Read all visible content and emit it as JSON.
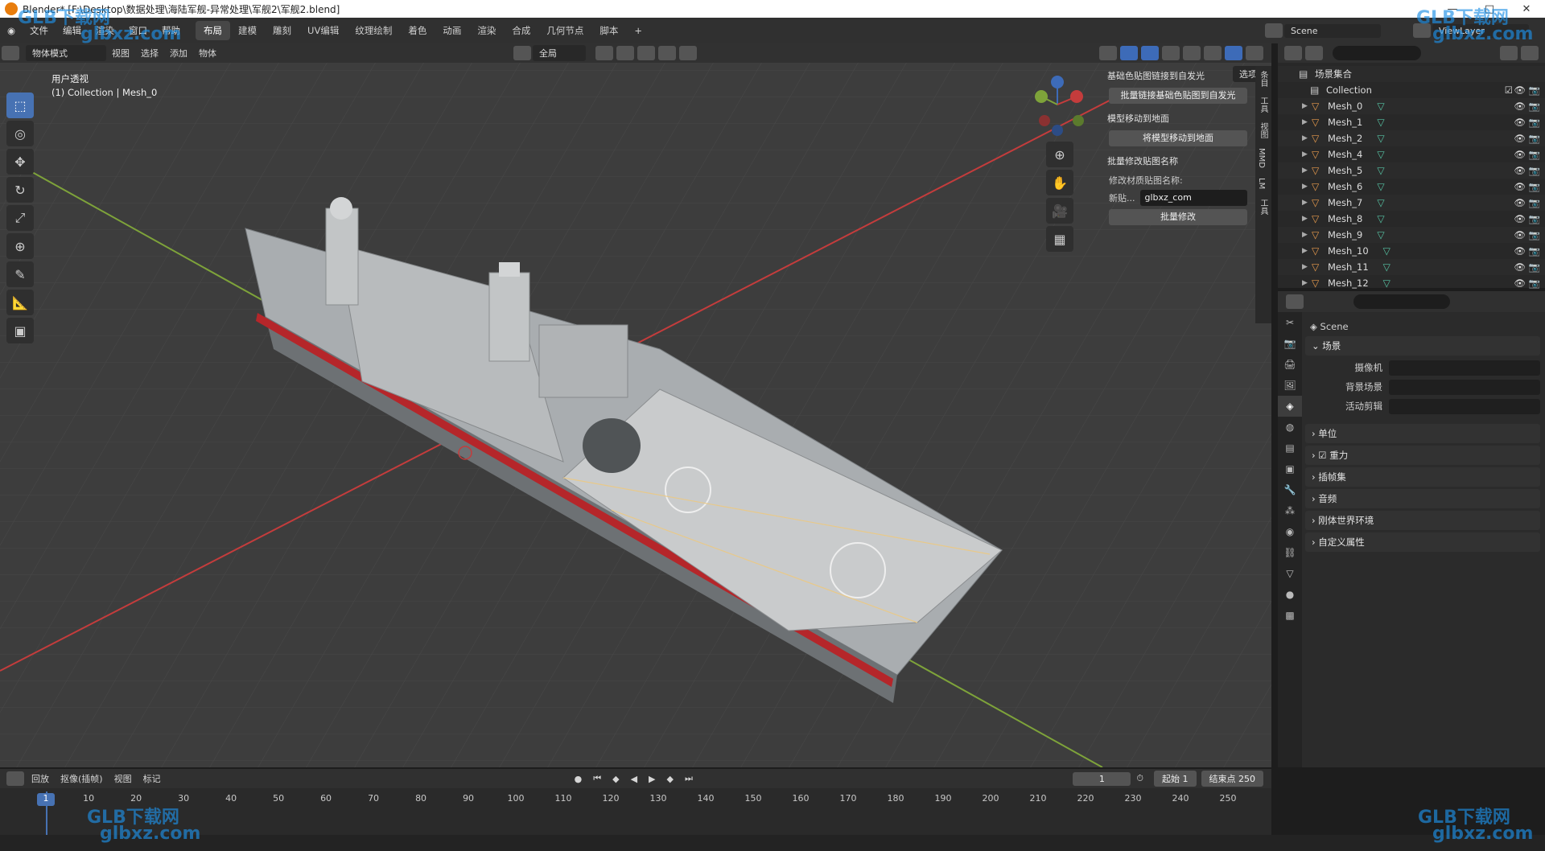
{
  "window": {
    "title": "Blender* [F:\\Desktop\\数据处理\\海陆军舰-异常处理\\军舰2\\军舰2.blend]"
  },
  "menus": [
    "文件",
    "编辑",
    "渲染",
    "窗口",
    "帮助"
  ],
  "workspaces": [
    "布局",
    "建模",
    "雕刻",
    "UV编辑",
    "纹理绘制",
    "着色",
    "动画",
    "渲染",
    "合成",
    "几何节点",
    "脚本"
  ],
  "active_workspace": "布局",
  "scene_name": "Scene",
  "view_layer": "ViewLayer",
  "viewport_header": {
    "mode": "物体模式",
    "menus": [
      "视图",
      "选择",
      "添加",
      "物体"
    ],
    "transform": "全局",
    "options": "选项"
  },
  "viewport_info": {
    "line1": "用户透视",
    "line2": "(1) Collection | Mesh_0"
  },
  "n_panel": {
    "section1": {
      "title": "基础色贴图链接到自发光",
      "button": "批量链接基础色贴图到自发光"
    },
    "section2": {
      "title": "模型移动到地面",
      "button": "将模型移动到地面"
    },
    "section3": {
      "title": "批量修改贴图名称",
      "label": "修改材质贴图名称:",
      "field_label": "新贴...",
      "field_value": "glbxz_com",
      "button": "批量修改"
    },
    "tabs": [
      "条目",
      "工具",
      "视图",
      "MMD",
      "LM",
      "工具"
    ]
  },
  "outliner": {
    "root": "场景集合",
    "collection": "Collection",
    "items": [
      "Mesh_0",
      "Mesh_1",
      "Mesh_2",
      "Mesh_4",
      "Mesh_5",
      "Mesh_6",
      "Mesh_7",
      "Mesh_8",
      "Mesh_9",
      "Mesh_10",
      "Mesh_11",
      "Mesh_12"
    ]
  },
  "properties": {
    "header": "Scene",
    "section": "场景",
    "fields": [
      {
        "label": "摄像机"
      },
      {
        "label": "背景场景"
      },
      {
        "label": "活动剪辑"
      }
    ],
    "collapsed": [
      "单位",
      "重力",
      "插帧集",
      "音频",
      "刚体世界环境",
      "自定义属性"
    ]
  },
  "timeline": {
    "menus": [
      "回放",
      "抠像(插帧)",
      "视图",
      "标记"
    ],
    "current_frame": "1",
    "start_label": "起始",
    "start": "1",
    "end_label": "结束点",
    "end": "250",
    "ticks": [
      "1",
      "10",
      "20",
      "30",
      "40",
      "50",
      "60",
      "70",
      "80",
      "90",
      "100",
      "110",
      "120",
      "130",
      "140",
      "150",
      "160",
      "170",
      "180",
      "190",
      "200",
      "210",
      "220",
      "230",
      "240",
      "250"
    ]
  },
  "watermark": {
    "brand": "GLB下载网",
    "url": "glbxz.com"
  },
  "colors": {
    "accent": "#4772b3",
    "viewport_bg": "#3d3d3d",
    "axis_x": "#c43c3c",
    "axis_y": "#7ea33a"
  }
}
